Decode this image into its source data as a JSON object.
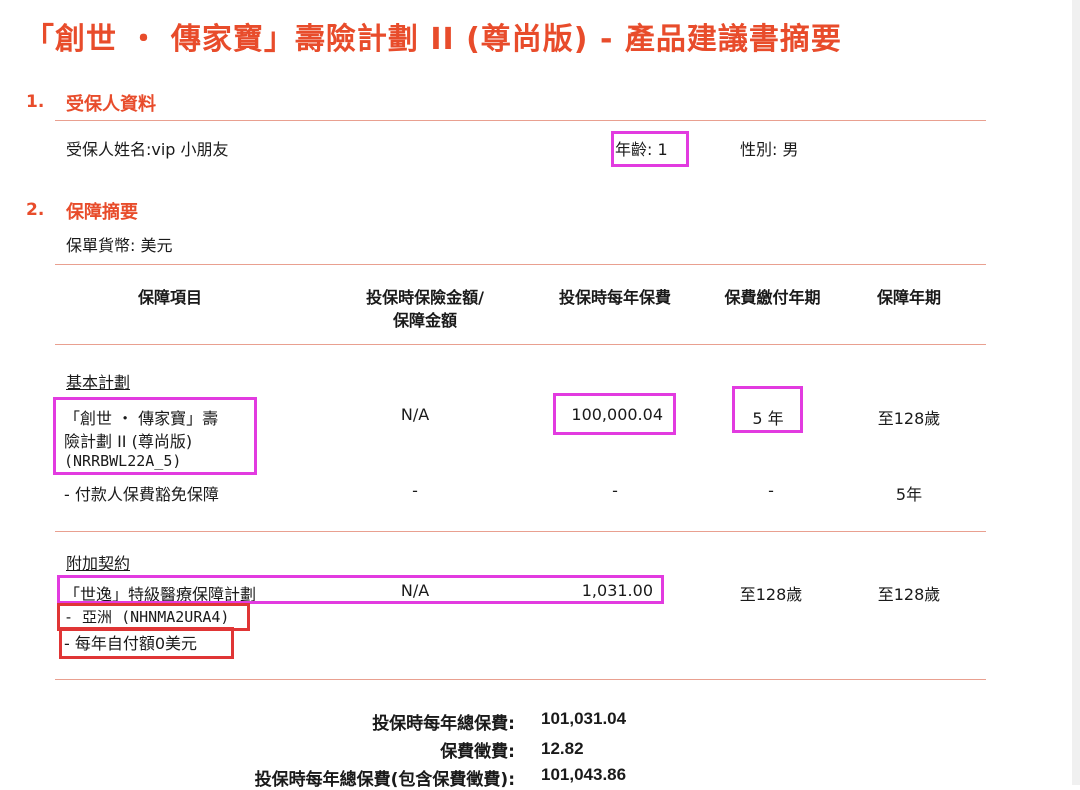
{
  "title": "「創世 ・ 傳家寶」壽險計劃 II (尊尚版) - 產品建議書摘要",
  "section1": {
    "number": "1.",
    "heading": "受保人資料",
    "name_text": "受保人姓名:vip  小朋友",
    "age_text": "年齡: 1",
    "gender_text": "性別: 男"
  },
  "section2": {
    "number": "2.",
    "heading": "保障摘要",
    "currency_text": "保單貨幣: 美元",
    "columns": {
      "item": "保障項目",
      "sum_line1": "投保時保險金額/",
      "sum_line2": "保障金額",
      "premium": "投保時每年保費",
      "pay_term": "保費繳付年期",
      "cover_term": "保障年期"
    },
    "basic": {
      "heading": "基本計劃",
      "plan_line1": "「創世 ・ 傳家寶」壽",
      "plan_line2": "險計劃 II (尊尚版)",
      "plan_code": "(NRRBWL22A_5)",
      "sum": "N/A",
      "premium": "100,000.04",
      "pay_term": "5 年",
      "cover_term": "至128歲",
      "waiver_label": "- 付款人保費豁免保障",
      "waiver_sum": "-",
      "waiver_premium": "-",
      "waiver_pay_term": "-",
      "waiver_cover_term": "5年"
    },
    "rider": {
      "heading": "附加契約",
      "plan_name": "「世逸」特級醫療保障計劃",
      "region": "- 亞洲 (NHNMA2URA4)",
      "deductible": "- 每年自付額0美元",
      "sum": "N/A",
      "premium": "1,031.00",
      "pay_term": "至128歲",
      "cover_term": "至128歲"
    }
  },
  "totals": {
    "annual_label": "投保時每年總保費:",
    "annual_value": "101,031.04",
    "levy_label": "保費徵費:",
    "levy_value": "12.82",
    "incl_label": "投保時每年總保費(包含保費徵費):",
    "incl_value": "101,043.86"
  },
  "colors": {
    "accent": "#e84c2b",
    "rule": "#e9a090",
    "highlight_magenta": "#e23be0",
    "highlight_red": "#e03535"
  }
}
